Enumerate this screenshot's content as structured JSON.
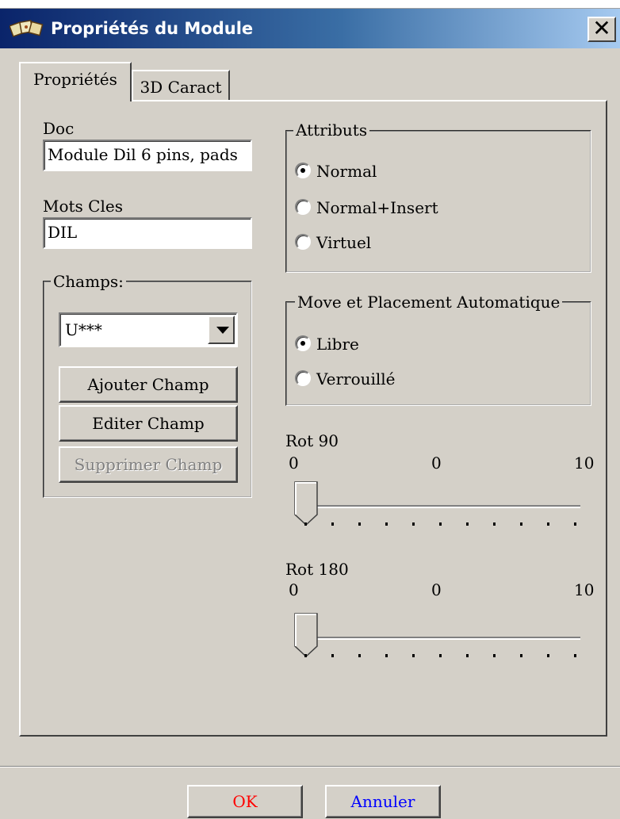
{
  "window": {
    "title": "Propriétés du Module",
    "close_label": "✕"
  },
  "tabs": [
    {
      "label": "Propriétés",
      "active": true
    },
    {
      "label": "3D Caract",
      "active": false
    }
  ],
  "doc": {
    "label": "Doc",
    "value": "Module Dil 6 pins, pads"
  },
  "keywords": {
    "label": "Mots Cles",
    "value": "DIL"
  },
  "fields": {
    "legend": "Champs:",
    "selected": "U***",
    "add_label": "Ajouter Champ",
    "edit_label": "Editer Champ",
    "delete_label": "Supprimer Champ"
  },
  "attributes": {
    "legend": "Attributs",
    "options": [
      {
        "label": "Normal",
        "checked": true
      },
      {
        "label": "Normal+Insert",
        "checked": false
      },
      {
        "label": "Virtuel",
        "checked": false
      }
    ]
  },
  "placement": {
    "legend": "Move et Placement Automatique",
    "options": [
      {
        "label": "Libre",
        "checked": true
      },
      {
        "label": "Verrouillé",
        "checked": false
      }
    ]
  },
  "rot90": {
    "label": "Rot 90",
    "min": "0",
    "value": "0",
    "max": "10",
    "value_fraction": 0
  },
  "rot180": {
    "label": "Rot 180",
    "min": "0",
    "value": "0",
    "max": "10",
    "value_fraction": 0
  },
  "buttons": {
    "ok": "OK",
    "cancel": "Annuler"
  },
  "colors": {
    "ok_text": "#ff0000",
    "cancel_text": "#0000ff",
    "title_bar": "#0a246a",
    "face": "#d4d0c8"
  }
}
